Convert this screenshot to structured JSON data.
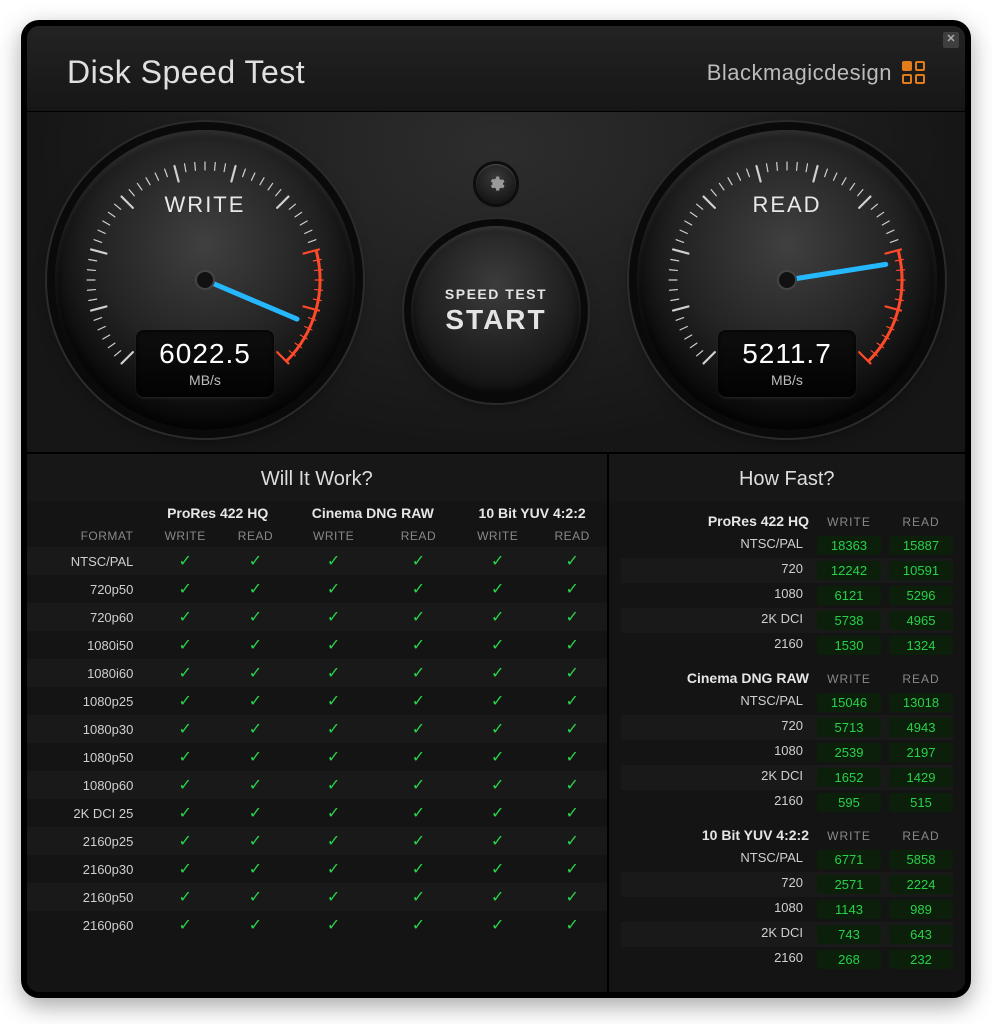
{
  "app_title": "Disk Speed Test",
  "brand": "Blackmagicdesign",
  "start_button": {
    "line1": "SPEED TEST",
    "line2": "START"
  },
  "gauges": {
    "write": {
      "label": "WRITE",
      "value": "6022.5",
      "unit": "MB/s",
      "needle_deg": 124
    },
    "read": {
      "label": "READ",
      "value": "5211.7",
      "unit": "MB/s",
      "needle_deg": 108
    }
  },
  "will_it_work": {
    "title": "Will It Work?",
    "format_header": "FORMAT",
    "sub_headers": [
      "WRITE",
      "READ"
    ],
    "groups": [
      "ProRes 422 HQ",
      "Cinema DNG RAW",
      "10 Bit YUV 4:2:2"
    ],
    "formats": [
      "NTSC/PAL",
      "720p50",
      "720p60",
      "1080i50",
      "1080i60",
      "1080p25",
      "1080p30",
      "1080p50",
      "1080p60",
      "2K DCI 25",
      "2160p25",
      "2160p30",
      "2160p50",
      "2160p60"
    ]
  },
  "how_fast": {
    "title": "How Fast?",
    "col_headers": [
      "WRITE",
      "READ"
    ],
    "groups": [
      {
        "name": "ProRes 422 HQ",
        "rows": [
          {
            "res": "NTSC/PAL",
            "write": "18363",
            "read": "15887"
          },
          {
            "res": "720",
            "write": "12242",
            "read": "10591"
          },
          {
            "res": "1080",
            "write": "6121",
            "read": "5296"
          },
          {
            "res": "2K DCI",
            "write": "5738",
            "read": "4965"
          },
          {
            "res": "2160",
            "write": "1530",
            "read": "1324"
          }
        ]
      },
      {
        "name": "Cinema DNG RAW",
        "rows": [
          {
            "res": "NTSC/PAL",
            "write": "15046",
            "read": "13018"
          },
          {
            "res": "720",
            "write": "5713",
            "read": "4943"
          },
          {
            "res": "1080",
            "write": "2539",
            "read": "2197"
          },
          {
            "res": "2K DCI",
            "write": "1652",
            "read": "1429"
          },
          {
            "res": "2160",
            "write": "595",
            "read": "515"
          }
        ]
      },
      {
        "name": "10 Bit YUV 4:2:2",
        "rows": [
          {
            "res": "NTSC/PAL",
            "write": "6771",
            "read": "5858"
          },
          {
            "res": "720",
            "write": "2571",
            "read": "2224"
          },
          {
            "res": "1080",
            "write": "1143",
            "read": "989"
          },
          {
            "res": "2K DCI",
            "write": "743",
            "read": "643"
          },
          {
            "res": "2160",
            "write": "268",
            "read": "232"
          }
        ]
      }
    ]
  }
}
